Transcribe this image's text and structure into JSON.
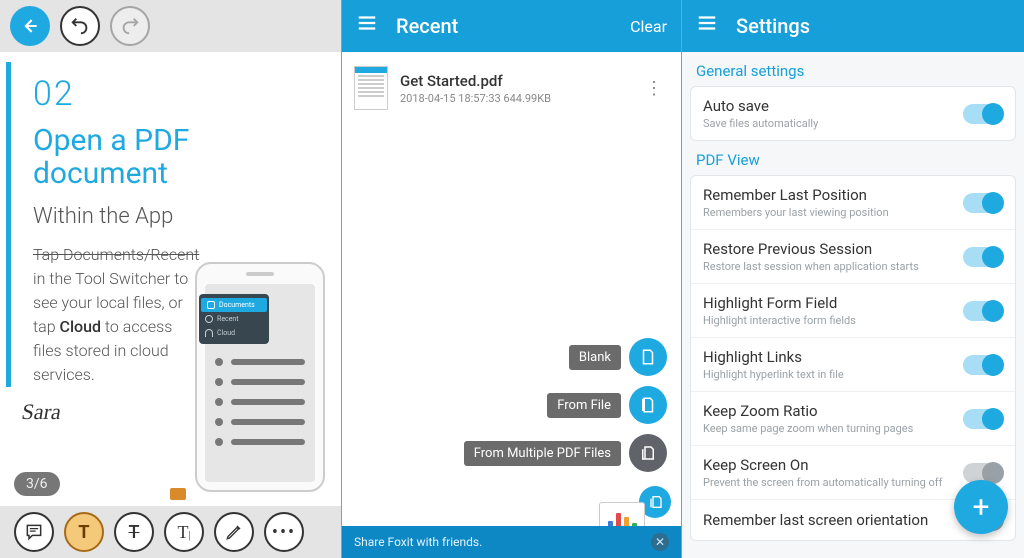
{
  "viewer": {
    "page_num": "02",
    "title_line1": "Open a PDF",
    "title_line2": "document",
    "subtitle": "Within the App",
    "body_st": "Tap Documents/Recent",
    "body_rest1": "in  the Tool Switcher to see your local files, or tap ",
    "body_bold": "Cloud",
    "body_rest2": " to access files stored in cloud services.",
    "signature": "Sara",
    "page_indicator": "3/6",
    "popover": {
      "documents": "Documents",
      "recent": "Recent",
      "cloud": "Cloud"
    }
  },
  "recent": {
    "title": "Recent",
    "clear": "Clear",
    "file": {
      "name": "Get Started.pdf",
      "meta": "2018-04-15 18:57:33 644.99KB"
    },
    "fab": {
      "blank": "Blank",
      "from_file": "From File",
      "from_multiple": "From Multiple PDF Files"
    },
    "share_text": "Share Foxit with friends."
  },
  "settings": {
    "title": "Settings",
    "general_h": "General settings",
    "pdfview_h": "PDF View",
    "items": {
      "autosave": {
        "t": "Auto save",
        "s": "Save files automatically",
        "on": true
      },
      "remember": {
        "t": "Remember Last Position",
        "s": "Remembers your last viewing position",
        "on": true
      },
      "restore": {
        "t": "Restore Previous Session",
        "s": "Restore last session when application starts",
        "on": true
      },
      "formfield": {
        "t": "Highlight Form Field",
        "s": "Highlight interactive form fields",
        "on": true
      },
      "links": {
        "t": "Highlight Links",
        "s": "Highlight hyperlink text in file",
        "on": true
      },
      "zoom": {
        "t": "Keep Zoom Ratio",
        "s": "Keep same page zoom when turning pages",
        "on": true
      },
      "screenon": {
        "t": "Keep Screen On",
        "s": "Prevent the screen from automatically turning off",
        "on": false
      },
      "orient": {
        "t": "Remember last screen orientation",
        "s": "",
        "on": false
      }
    }
  }
}
